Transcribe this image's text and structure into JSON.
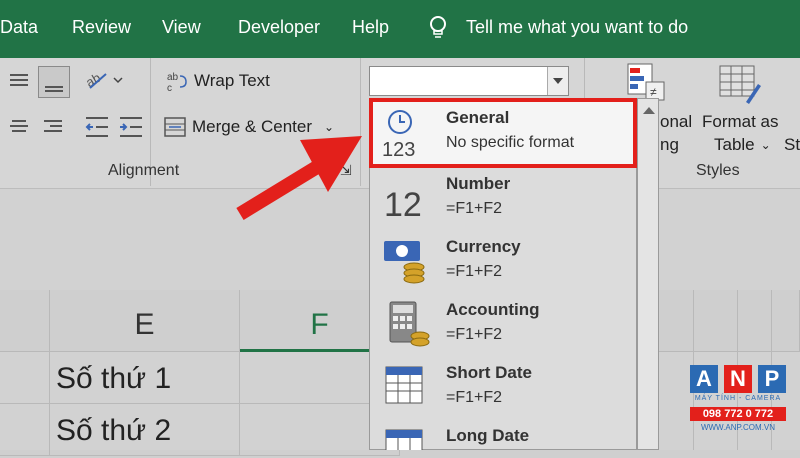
{
  "ribbon_tabs": [
    "Data",
    "Review",
    "View",
    "Developer",
    "Help"
  ],
  "tell_me": "Tell me what you want to do",
  "ribbon": {
    "wrap_text": "Wrap Text",
    "merge_center": "Merge & Center",
    "alignment_group": "Alignment",
    "conditional_partial": "onal",
    "conditional_partial2": "ng",
    "format_as": "Format as",
    "table": "Table",
    "cell_styles_partial": "St",
    "styles_group": "Styles"
  },
  "number_format_box": {
    "value": ""
  },
  "format_menu": [
    {
      "name": "General",
      "sub": "No specific format",
      "icon": "clock-123-icon"
    },
    {
      "name": "Number",
      "sub": "=F1+F2",
      "icon": "number-12-icon"
    },
    {
      "name": "Currency",
      "sub": "=F1+F2",
      "icon": "currency-coins-icon"
    },
    {
      "name": "Accounting",
      "sub": "=F1+F2",
      "icon": "calculator-icon"
    },
    {
      "name": "Short Date",
      "sub": "=F1+F2",
      "icon": "calendar-icon"
    },
    {
      "name": "Long Date",
      "sub": "",
      "icon": "calendar-icon"
    }
  ],
  "sheet": {
    "columns": [
      "E",
      "F"
    ],
    "cells": [
      "Số thứ 1",
      "Số thứ 2"
    ]
  },
  "logo": {
    "letters": [
      "A",
      "N",
      "P"
    ],
    "tagline": "MÁY TÍNH - CAMERA",
    "phone": "098 772 0 772",
    "website": "WWW.ANP.COM.VN"
  },
  "colors": {
    "excel_green": "#217346",
    "highlight_red": "#e3201b",
    "logo_blue": "#2b6ab3"
  }
}
